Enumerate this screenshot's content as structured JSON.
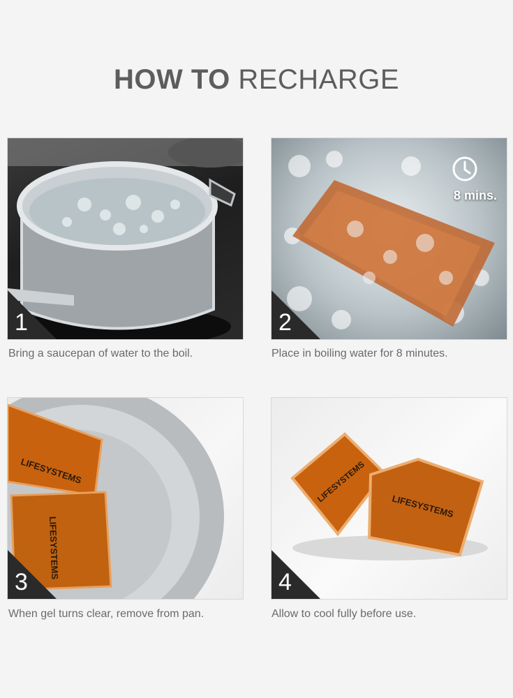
{
  "header": {
    "title_bold": "HOW TO",
    "title_light": "RECHARGE"
  },
  "steps": [
    {
      "number": "1",
      "caption": "Bring a saucepan of water to the boil."
    },
    {
      "number": "2",
      "caption": "Place in boiling water for 8 minutes.",
      "timer_label": "8 mins."
    },
    {
      "number": "3",
      "caption": "When gel turns clear, remove from pan."
    },
    {
      "number": "4",
      "caption": "Allow to cool fully before use."
    }
  ],
  "pack_brand": "LIFESYSTEMS",
  "icons": {
    "timer": "clock-icon"
  },
  "colors": {
    "title": "#5d5d5d",
    "caption": "#6a6a6a",
    "badge": "#2a2a2a",
    "gel": "#c8620e"
  }
}
